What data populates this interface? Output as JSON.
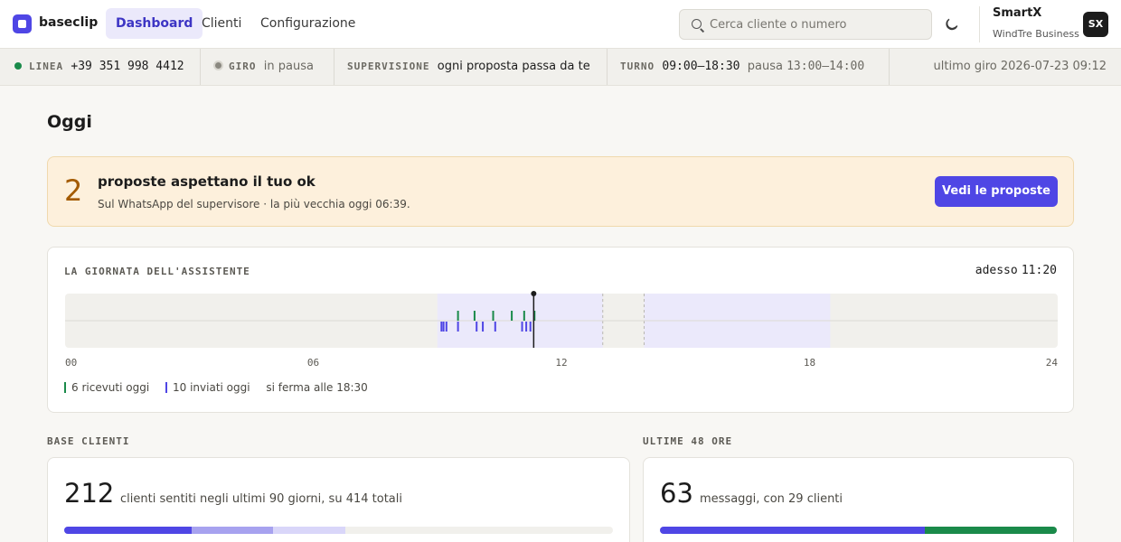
{
  "app": {
    "brand": "baseclip"
  },
  "nav": {
    "items": [
      "Dashboard",
      "Clienti",
      "Configurazione"
    ],
    "active": "Dashboard"
  },
  "search": {
    "placeholder": "Cerca cliente o numero"
  },
  "user": {
    "name": "SmartX",
    "org": "WindTre Business",
    "initials": "SX"
  },
  "status": {
    "linea": {
      "label": "LINEA",
      "value": "+39 351 998 4412"
    },
    "giro": {
      "label": "GIRO",
      "value": "in pausa"
    },
    "supervisione": {
      "label": "SUPERVISIONE",
      "value": "ogni proposta passa da te"
    },
    "turno": {
      "label": "TURNO",
      "hours": "09:00–18:30",
      "pause_label": "pausa",
      "pause": "13:00–14:00"
    },
    "last_run": "ultimo giro 2026-07-23 09:12"
  },
  "page": {
    "title": "Oggi"
  },
  "alert": {
    "count": "2",
    "title": "proposte aspettano il tuo ok",
    "subtitle": "Sul WhatsApp del supervisore · la più vecchia oggi 06:39.",
    "button": "Vedi le proposte"
  },
  "timeline": {
    "label": "LA GIORNATA DELL'ASSISTENTE",
    "now_label": "adesso",
    "now": "11:20",
    "hour_ticks": [
      "00",
      "06",
      "12",
      "18",
      "24"
    ],
    "legend": {
      "received": "6 ricevuti oggi",
      "sent": "10 inviati oggi",
      "stop": "si ferma alle 18:30"
    }
  },
  "chart_data": {
    "type": "timeline",
    "x_range_hours": [
      0,
      24
    ],
    "now_hours": 11.33,
    "active_window_hours": [
      9,
      18.5
    ],
    "pause_window_hours": [
      13,
      14
    ],
    "received_hours": [
      9.5,
      9.9,
      10.35,
      10.8,
      11.1,
      11.35
    ],
    "sent_hours": [
      9.1,
      9.15,
      9.22,
      9.5,
      9.95,
      10.1,
      10.4,
      11.05,
      11.15,
      11.25
    ],
    "colors": {
      "received": "#1a8a4a",
      "sent": "#4f46e5",
      "active": "#ebe9fb",
      "idle": "#f1f0ec"
    }
  },
  "base_clienti": {
    "label": "BASE CLIENTI",
    "value": "212",
    "description": "clienti sentiti negli ultimi 90 giorni, su 414 totali",
    "segments": [
      {
        "fraction": 0.232,
        "color": "#4f46e5"
      },
      {
        "fraction": 0.149,
        "color": "#a7a2ef"
      },
      {
        "fraction": 0.132,
        "color": "#d9d6f9"
      }
    ]
  },
  "ultime48": {
    "label": "ULTIME 48 ORE",
    "value": "63",
    "description": "messaggi, con 29 clienti",
    "segments": [
      {
        "fraction": 0.667,
        "color": "#4f46e5"
      },
      {
        "fraction": 0.333,
        "color": "#1a8a4a"
      }
    ]
  }
}
